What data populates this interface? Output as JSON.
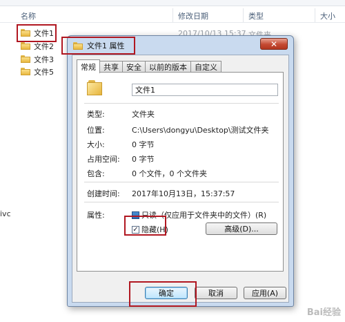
{
  "explorer": {
    "columns": [
      "名称",
      "修改日期",
      "类型",
      "大小"
    ],
    "files": [
      {
        "name": "文件1",
        "date": "2017/10/13 15:37",
        "type": "文件夹"
      },
      {
        "name": "文件2"
      },
      {
        "name": "文件3"
      },
      {
        "name": "文件5"
      }
    ],
    "nav_cut_label": "ivc"
  },
  "dialog": {
    "title": "文件1 属性",
    "close_label": "✕",
    "tabs": [
      "常规",
      "共享",
      "安全",
      "以前的版本",
      "自定义"
    ],
    "name_value": "文件1",
    "fields": {
      "type_label": "类型:",
      "type_value": "文件夹",
      "location_label": "位置:",
      "location_value": "C:\\Users\\dongyu\\Desktop\\测试文件夹",
      "size_label": "大小:",
      "size_value": "0 字节",
      "disk_label": "占用空间:",
      "disk_value": "0 字节",
      "contains_label": "包含:",
      "contains_value": "0 个文件，0 个文件夹",
      "created_label": "创建时间:",
      "created_value": "2017年10月13日，15:37:57",
      "attributes_label": "属性:"
    },
    "readonly_label": "只读（仅应用于文件夹中的文件）(R)",
    "hidden_label": "隐藏(H)",
    "advanced_label": "高级(D)...",
    "ok_label": "确定",
    "cancel_label": "取消",
    "apply_label": "应用(A)"
  },
  "watermark": "Bai经验"
}
